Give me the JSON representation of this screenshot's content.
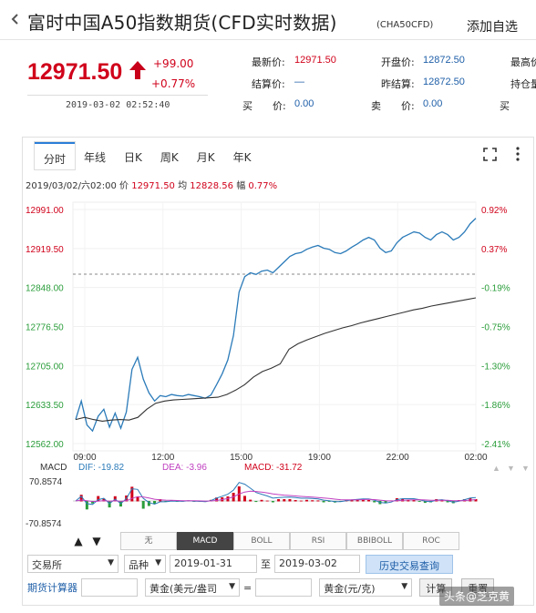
{
  "header": {
    "title": "富时中国A50指数期货(CFD实时数据)",
    "code": "(CHA50CFD)",
    "add_fav": "添加自选"
  },
  "quote": {
    "price": "12971.50",
    "change": "+99.00",
    "change_pct": "+0.77%",
    "time": "2019-03-02  02:52:40"
  },
  "fields": {
    "latest_label": "最新价:",
    "latest_value": "12971.50",
    "open_label": "开盘价:",
    "open_value": "12872.50",
    "high_label": "最高价",
    "settle_label": "结算价:",
    "settle_value": "—",
    "prev_settle_label": "昨结算:",
    "prev_settle_value": "12872.50",
    "hold_label": "持仓量",
    "buy_label": "买　　价:",
    "buy_value": "0.00",
    "sell_label": "卖　　价:",
    "sell_value": "0.00",
    "buy2_label": "买"
  },
  "tabs": [
    "分时",
    "年线",
    "日K",
    "周K",
    "月K",
    "年K"
  ],
  "active_tab": 0,
  "info": {
    "date": "2019/03/02/六02:00",
    "price_label": "价",
    "price": "12971.50",
    "avg_label": "均",
    "avg": "12828.56",
    "amp_label": "幅",
    "amp": "0.77%"
  },
  "chart_data": {
    "type": "line",
    "title": "",
    "xlabel": "",
    "ylabel": "",
    "ylim": [
      12562.0,
      12991.0
    ],
    "y_ticks_left": [
      "12991.00",
      "12919.50",
      "12848.00",
      "12776.50",
      "12705.00",
      "12633.50",
      "12562.00"
    ],
    "y_ticks_right": [
      "0.92%",
      "0.37%",
      "-0.19%",
      "-0.75%",
      "-1.30%",
      "-1.86%",
      "-2.41%"
    ],
    "x_ticks": [
      "09:00",
      "12:00",
      "15:00",
      "19:00",
      "22:00",
      "02:00"
    ],
    "prev_close": 12872.5,
    "series": [
      {
        "name": "价",
        "color": "#2b7bb9",
        "values": [
          12606,
          12640,
          12596,
          12585,
          12612,
          12625,
          12592,
          12618,
          12590,
          12620,
          12698,
          12720,
          12680,
          12655,
          12640,
          12650,
          12648,
          12652,
          12650,
          12649,
          12652,
          12650,
          12648,
          12645,
          12651,
          12670,
          12690,
          12715,
          12760,
          12840,
          12868,
          12875,
          12872,
          12878,
          12880,
          12875,
          12885,
          12895,
          12905,
          12910,
          12912,
          12918,
          12922,
          12925,
          12920,
          12918,
          12912,
          12910,
          12915,
          12922,
          12928,
          12935,
          12940,
          12935,
          12920,
          12912,
          12915,
          12930,
          12940,
          12945,
          12950,
          12948,
          12940,
          12935,
          12945,
          12950,
          12945,
          12935,
          12940,
          12950,
          12965,
          12975
        ]
      },
      {
        "name": "均",
        "color": "#333333",
        "values": [
          12606,
          12610,
          12606,
          12603,
          12605,
          12606,
          12605,
          12610,
          12625,
          12636,
          12640,
          12642,
          12643,
          12644,
          12645,
          12646,
          12647,
          12652,
          12660,
          12670,
          12684,
          12694,
          12700,
          12708,
          12735,
          12745,
          12752,
          12758,
          12764,
          12769,
          12774,
          12778,
          12783,
          12787,
          12791,
          12795,
          12799,
          12803,
          12807,
          12810,
          12814,
          12817,
          12820,
          12823,
          12826,
          12829
        ]
      }
    ],
    "macd": {
      "label": "MACD",
      "dif_label": "DIF: -19.82",
      "dea_label": "DEA: -3.96",
      "macd_label": "MACD: -31.72",
      "y_top": "70.8574",
      "y_bottom": "-70.8574"
    }
  },
  "indicators": [
    "无",
    "MACD",
    "BOLL",
    "RSI",
    "BBIBOLL",
    "ROC"
  ],
  "active_indicator": 1,
  "form": {
    "exchange": "交易所",
    "variety": "品种",
    "start_date": "2019-01-31",
    "to": "至",
    "end_date": "2019-03-02",
    "query_button": "历史交易查询",
    "calc_label": "期货计算器",
    "unit1": "黄金(美元/盎司",
    "equals": "=",
    "unit2": "黄金(元/克)",
    "calc_button": "计算",
    "reset_button": "重置"
  },
  "colors": {
    "up": "#d0021b",
    "down": "#2a9d3a",
    "price_line": "#2b7bb9",
    "accent": "#2a7ed8"
  },
  "watermark": "头条@芝克黄"
}
